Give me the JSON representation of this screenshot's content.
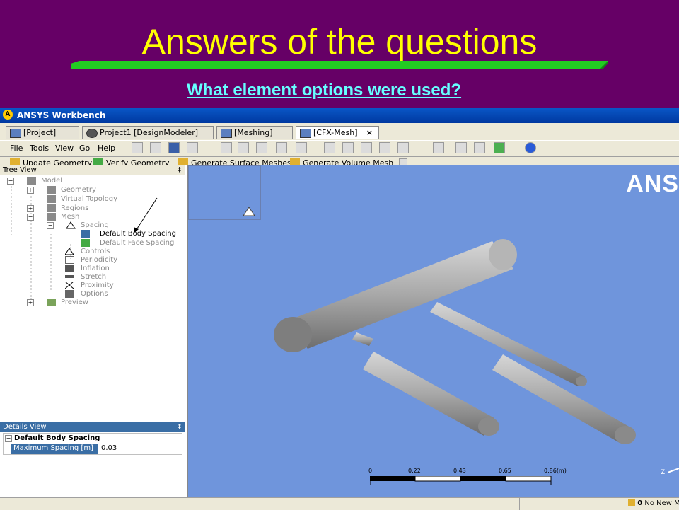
{
  "slide": {
    "title": "Answers of the questions",
    "subtitle": "What element options were used?"
  },
  "app": {
    "title": "ANSYS Workbench",
    "tabs": [
      {
        "label": "[Project]"
      },
      {
        "label": "Project1 [DesignModeler]"
      },
      {
        "label": "[Meshing]"
      },
      {
        "label": "[CFX-Mesh]",
        "close": "×"
      }
    ],
    "menu": [
      "File",
      "Tools",
      "View",
      "Go",
      "Help"
    ],
    "toolbar2": {
      "update_geometry": "Update Geometry",
      "verify_geometry": "Verify Geometry",
      "generate_surface": "Generate Surface Meshes",
      "generate_volume": "Generate Volume Mesh"
    }
  },
  "tree": {
    "header": "Tree View",
    "pin": "‡",
    "items": [
      {
        "label": "Model"
      },
      {
        "label": "Geometry"
      },
      {
        "label": "Virtual Topology"
      },
      {
        "label": "Regions"
      },
      {
        "label": "Mesh"
      },
      {
        "label": "Spacing"
      },
      {
        "label": "Default Body Spacing"
      },
      {
        "label": "Default Face Spacing"
      },
      {
        "label": "Controls"
      },
      {
        "label": "Periodicity"
      },
      {
        "label": "Inflation"
      },
      {
        "label": "Stretch"
      },
      {
        "label": "Proximity"
      },
      {
        "label": "Options"
      },
      {
        "label": "Preview"
      }
    ]
  },
  "details": {
    "header": "Details View",
    "pin": "‡",
    "group": "Default Body Spacing",
    "rows": [
      {
        "name": "Maximum Spacing [m]",
        "value": "0.03"
      }
    ]
  },
  "viewport": {
    "logo": "ANS",
    "scale_ticks": [
      "0",
      "0.22",
      "0.43",
      "0.65",
      "0.86(m)"
    ],
    "axis_label": "Z"
  },
  "status": {
    "right": "No New M",
    "count": "0"
  },
  "colors": {
    "slide_bg": "#660066",
    "title": "#ffff00",
    "subtitle": "#66ffff",
    "viewport": "#6f95dc",
    "selection": "#3a6ea5"
  }
}
